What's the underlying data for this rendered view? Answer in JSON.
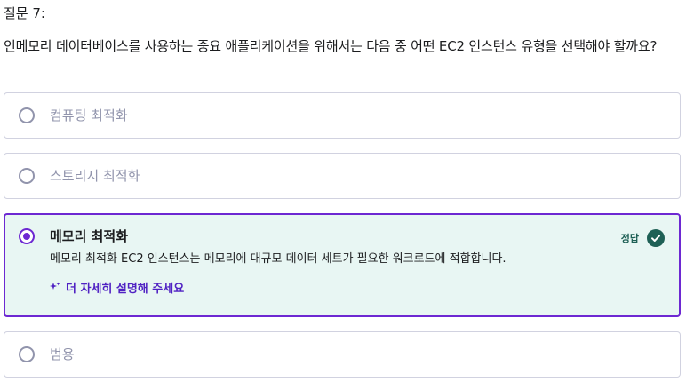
{
  "question": {
    "number_label": "질문 7:",
    "text": "인메모리 데이터베이스를 사용하는 중요 애플리케이션을 위해서는 다음 중 어떤 EC2 인스턴스 유형을 선택해야 할까요?"
  },
  "options": [
    {
      "label": "컴퓨팅 최적화",
      "selected": false
    },
    {
      "label": "스토리지 최적화",
      "selected": false
    },
    {
      "label": "메모리 최적화",
      "selected": true,
      "correct": true,
      "correct_label": "정답",
      "explanation": "메모리 최적화 EC2 인스턴스는 메모리에 대규모 데이터 세트가 필요한 워크로드에 적합합니다.",
      "more_link_label": "더 자세히 설명해 주세요"
    },
    {
      "label": "범용",
      "selected": false
    }
  ],
  "colors": {
    "accent": "#6d28d2",
    "correct": "#1e6055",
    "correct_bg": "#e8f6f3",
    "muted_text": "#9194ac"
  }
}
